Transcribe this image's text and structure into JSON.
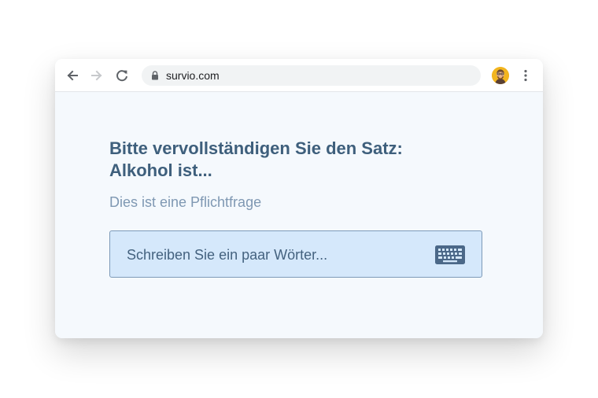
{
  "browser": {
    "url": "survio.com",
    "icons": {
      "back": "arrow-left-icon",
      "forward": "arrow-right-icon",
      "reload": "reload-icon",
      "lock": "lock-icon",
      "avatar": "profile-avatar",
      "menu": "more-vertical-icon"
    }
  },
  "survey": {
    "question_line_1": "Bitte vervollständigen Sie den Satz:",
    "question_line_2": "Alkohol ist...",
    "required_note": "Dies ist eine Pflichtfrage",
    "answer_placeholder": "Schreiben Sie ein paar Wörter...",
    "answer_icon": "keyboard-icon"
  },
  "colors": {
    "page_background": "#ffffff",
    "content_background": "#f5f9fd",
    "heading": "#3e5f7c",
    "muted": "#7f98b3",
    "input_background": "#d5e8fb",
    "input_border": "#7d9ab8",
    "keyboard_icon": "#4b6888"
  }
}
